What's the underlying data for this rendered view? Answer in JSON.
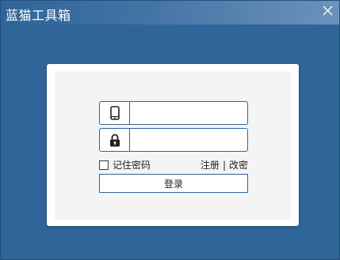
{
  "window": {
    "title": "蓝猫工具箱"
  },
  "login": {
    "phone_input": {
      "value": "",
      "placeholder": ""
    },
    "password_input": {
      "value": "",
      "placeholder": ""
    },
    "remember_label": "记住密码",
    "register_link": "注册",
    "separator": "|",
    "change_password_link": "改密",
    "login_button": "登录"
  },
  "icons": {
    "close": "close-icon",
    "phone": "phone-icon",
    "lock": "lock-icon"
  },
  "colors": {
    "window_background": "#2f6598",
    "accent_border": "#2f6598",
    "card_background": "#ffffff",
    "panel_background": "#f4f4f4"
  }
}
